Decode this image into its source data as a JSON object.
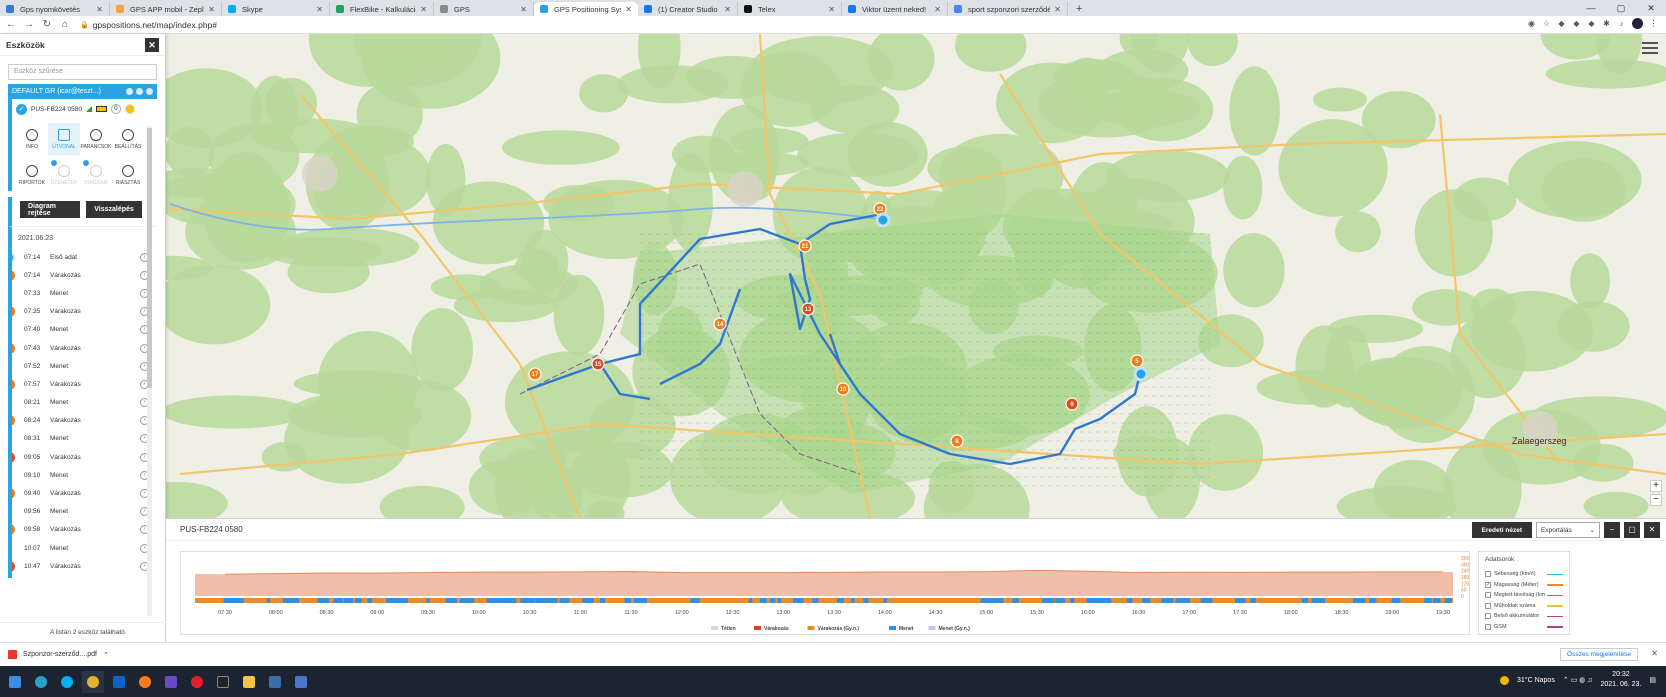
{
  "browser": {
    "tabs": [
      {
        "title": "Gps nyomkövetés",
        "fav": "#3a7bd5",
        "active": false
      },
      {
        "title": "GPS APP mobil - Zeplin",
        "fav": "#f2a541",
        "active": false
      },
      {
        "title": "Skype",
        "fav": "#00aff0",
        "active": false
      },
      {
        "title": "FlexBike - Kalkuláció - Google Sh",
        "fav": "#1fa463",
        "active": false
      },
      {
        "title": "GPS",
        "fav": "#888888",
        "active": false
      },
      {
        "title": "GPS Positioning System - pusztc",
        "fav": "#29a3e6",
        "active": true
      },
      {
        "title": "(1) Creator Studio",
        "fav": "#1877f2",
        "active": false
      },
      {
        "title": "Telex",
        "fav": "#111111",
        "active": false
      },
      {
        "title": "Viktor üzent neked!",
        "fav": "#1877f2",
        "active": false
      },
      {
        "title": "sport szponzori szerződés - Goo",
        "fav": "#4285f4",
        "active": false
      }
    ],
    "url": "gpspositions.net/map/index.php#"
  },
  "sidebar": {
    "title": "Eszközök",
    "search_placeholder": "Eszköz szűrése",
    "group": "DEFAULT GR (icar@teszt...)",
    "device": {
      "name": "PUS-FB224 0580",
      "badge": "0"
    },
    "menu": [
      {
        "label": "INFO",
        "icon": "info-icon",
        "state": "normal"
      },
      {
        "label": "ÚTVONAL",
        "icon": "route-icon",
        "state": "selected"
      },
      {
        "label": "PARANCSOK",
        "icon": "commands-icon",
        "state": "normal"
      },
      {
        "label": "BEÁLLÍTÁS",
        "icon": "gear-icon",
        "state": "normal"
      },
      {
        "label": "RIPORTOK",
        "icon": "report-icon",
        "state": "normal"
      },
      {
        "label": "ÜZENETEK",
        "icon": "message-icon",
        "state": "disabled"
      },
      {
        "label": "DIAGRAM",
        "icon": "chart-icon",
        "state": "disabled"
      },
      {
        "label": "RIASZTÁS",
        "icon": "alarm-icon",
        "state": "normal"
      }
    ],
    "btn_diagram": "Diagram rejtése",
    "btn_back": "Visszalépés",
    "date": "2021.06.23",
    "events": [
      {
        "time": "07:14",
        "type": "Első adat",
        "kind": "s",
        "n": ""
      },
      {
        "time": "07:14",
        "type": "Várakozás",
        "kind": "w",
        "n": "1"
      },
      {
        "time": "07:33",
        "type": "Menet",
        "kind": "m",
        "n": ""
      },
      {
        "time": "07:35",
        "type": "Várakozás",
        "kind": "w",
        "n": "2"
      },
      {
        "time": "07:40",
        "type": "Menet",
        "kind": "m",
        "n": ""
      },
      {
        "time": "07:43",
        "type": "Várakozás",
        "kind": "w",
        "n": "3"
      },
      {
        "time": "07:52",
        "type": "Menet",
        "kind": "m",
        "n": ""
      },
      {
        "time": "07:57",
        "type": "Várakozás",
        "kind": "w",
        "n": "4"
      },
      {
        "time": "08:21",
        "type": "Menet",
        "kind": "m",
        "n": ""
      },
      {
        "time": "08:24",
        "type": "Várakozás",
        "kind": "w",
        "n": "5"
      },
      {
        "time": "08:31",
        "type": "Menet",
        "kind": "m",
        "n": ""
      },
      {
        "time": "09:05",
        "type": "Várakozás",
        "kind": "r",
        "n": "6"
      },
      {
        "time": "09:10",
        "type": "Menet",
        "kind": "m",
        "n": ""
      },
      {
        "time": "09:40",
        "type": "Várakozás",
        "kind": "w",
        "n": "7"
      },
      {
        "time": "09:56",
        "type": "Menet",
        "kind": "m",
        "n": ""
      },
      {
        "time": "09:58",
        "type": "Várakozás",
        "kind": "w",
        "n": "8"
      },
      {
        "time": "10:07",
        "type": "Menet",
        "kind": "m",
        "n": ""
      },
      {
        "time": "10:47",
        "type": "Várakozás",
        "kind": "r",
        "n": "9"
      }
    ],
    "footer": "A listán 2 eszköz található."
  },
  "map": {
    "markers": [
      {
        "n": "22",
        "color": "#f07c1a"
      },
      {
        "n": "21",
        "color": "#f07c1a"
      },
      {
        "n": "13",
        "color": "#e04a20"
      },
      {
        "n": "14",
        "color": "#f07c1a"
      },
      {
        "n": "15",
        "color": "#e04a20"
      },
      {
        "n": "17",
        "color": "#f07c1a"
      },
      {
        "n": "10",
        "color": "#f07c1a"
      },
      {
        "n": "8",
        "color": "#f07c1a"
      },
      {
        "n": "6",
        "color": "#e04a20"
      },
      {
        "n": "5",
        "color": "#f07c1a"
      }
    ],
    "town_labels": [
      "Zalaegerszeg"
    ]
  },
  "panel": {
    "device": "PUS-FB224 0580",
    "orig_view": "Eredeti nézet",
    "export": "Exportálás"
  },
  "chart_data": {
    "type": "area",
    "x": [
      "07:30",
      "08:00",
      "08:30",
      "09:00",
      "09:30",
      "10:00",
      "10:30",
      "11:00",
      "11:30",
      "12:00",
      "12:30",
      "13:00",
      "13:30",
      "14:00",
      "14:30",
      "15:00",
      "15:30",
      "16:00",
      "16:30",
      "17:00",
      "17:30",
      "18:00",
      "18:30",
      "19:00",
      "19:30"
    ],
    "y_ticks": [
      "360",
      "300",
      "240",
      "180",
      "120",
      "60",
      "0"
    ],
    "series": [
      {
        "name": "Magasság (Méter)",
        "values": [
          210,
          215,
          220,
          218,
          222,
          225,
          224,
          226,
          228,
          226,
          224,
          223,
          225,
          227,
          226,
          228,
          240,
          230,
          226,
          228,
          226,
          227,
          226,
          227,
          226
        ]
      }
    ],
    "legend": [
      {
        "name": "Tétlen",
        "color": "#d9d9d9"
      },
      {
        "name": "Várakozás",
        "color": "#d9401c"
      },
      {
        "name": "Várakozás (Gy.n.)",
        "color": "#f08a24"
      },
      {
        "name": "Menet",
        "color": "#2f8ee5"
      },
      {
        "name": "Menet (Gy.n.)",
        "color": "#b8c6f0"
      }
    ]
  },
  "data_series": {
    "title": "Adatsorok",
    "items": [
      {
        "label": "Sebesség (km/ó)",
        "checked": false,
        "color": "#29b6e6"
      },
      {
        "label": "Magasság (Méter)",
        "checked": true,
        "color": "#f08a24"
      },
      {
        "label": "Megtett távolság (km)",
        "checked": false,
        "color": "#3fa34d"
      },
      {
        "label": "Műholdak száma",
        "checked": false,
        "color": "#e8c43a"
      },
      {
        "label": "Belső akkumulátor",
        "checked": false,
        "color": "#c0398f"
      },
      {
        "label": "GSM",
        "checked": false,
        "color": "#b03aa8"
      }
    ]
  },
  "download": {
    "file": "Szponzor-szerződ....pdf",
    "show_all": "Összes megjelenítése"
  },
  "taskbar": {
    "weather": "31°C Napos",
    "time": "20:32",
    "date": "2021. 06. 23."
  }
}
